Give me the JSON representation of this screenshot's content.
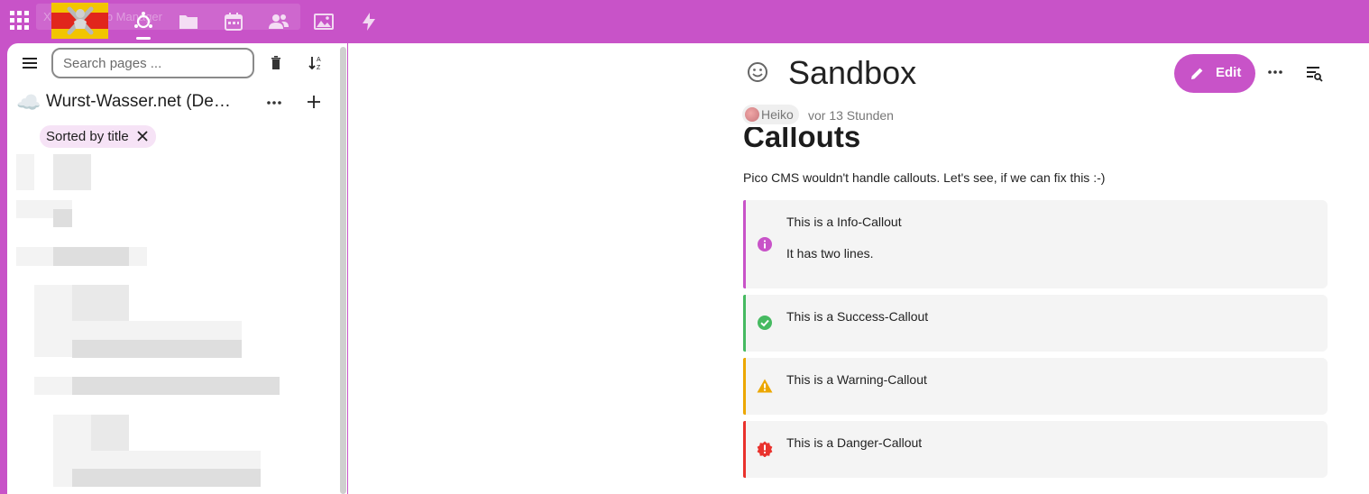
{
  "topbar": {
    "tooltip_text": "X ... from Tab Manager",
    "nav_icons": [
      "collectives-icon",
      "files-icon",
      "calendar-icon",
      "contacts-icon",
      "photos-icon",
      "activity-icon"
    ],
    "accent": "#c853c8"
  },
  "sidebar": {
    "search": {
      "placeholder": "Search pages ...",
      "value": ""
    },
    "collective": {
      "emoji": "☁️",
      "name": "Wurst-Wasser.net (Deep-Thoughts)"
    },
    "sort_chip": "Sorted by title"
  },
  "page": {
    "title": "Sandbox",
    "edit_label": "Edit",
    "author": "Heiko",
    "last_edit": "vor 13 Stunden",
    "heading": "Callouts",
    "intro": "Pico CMS wouldn't handle callouts. Let's see, if we can fix this :-)",
    "callouts": {
      "info": {
        "line1": "This is a Info-Callout",
        "line2": "It has two lines.",
        "color": "#c853c8"
      },
      "success": {
        "text": "This is a Success-Callout",
        "color": "#46ba61"
      },
      "warning": {
        "text": "This is a Warning-Callout",
        "color": "#eca700"
      },
      "danger": {
        "text": "This is a Danger-Callout",
        "color": "#e9322d"
      }
    }
  }
}
